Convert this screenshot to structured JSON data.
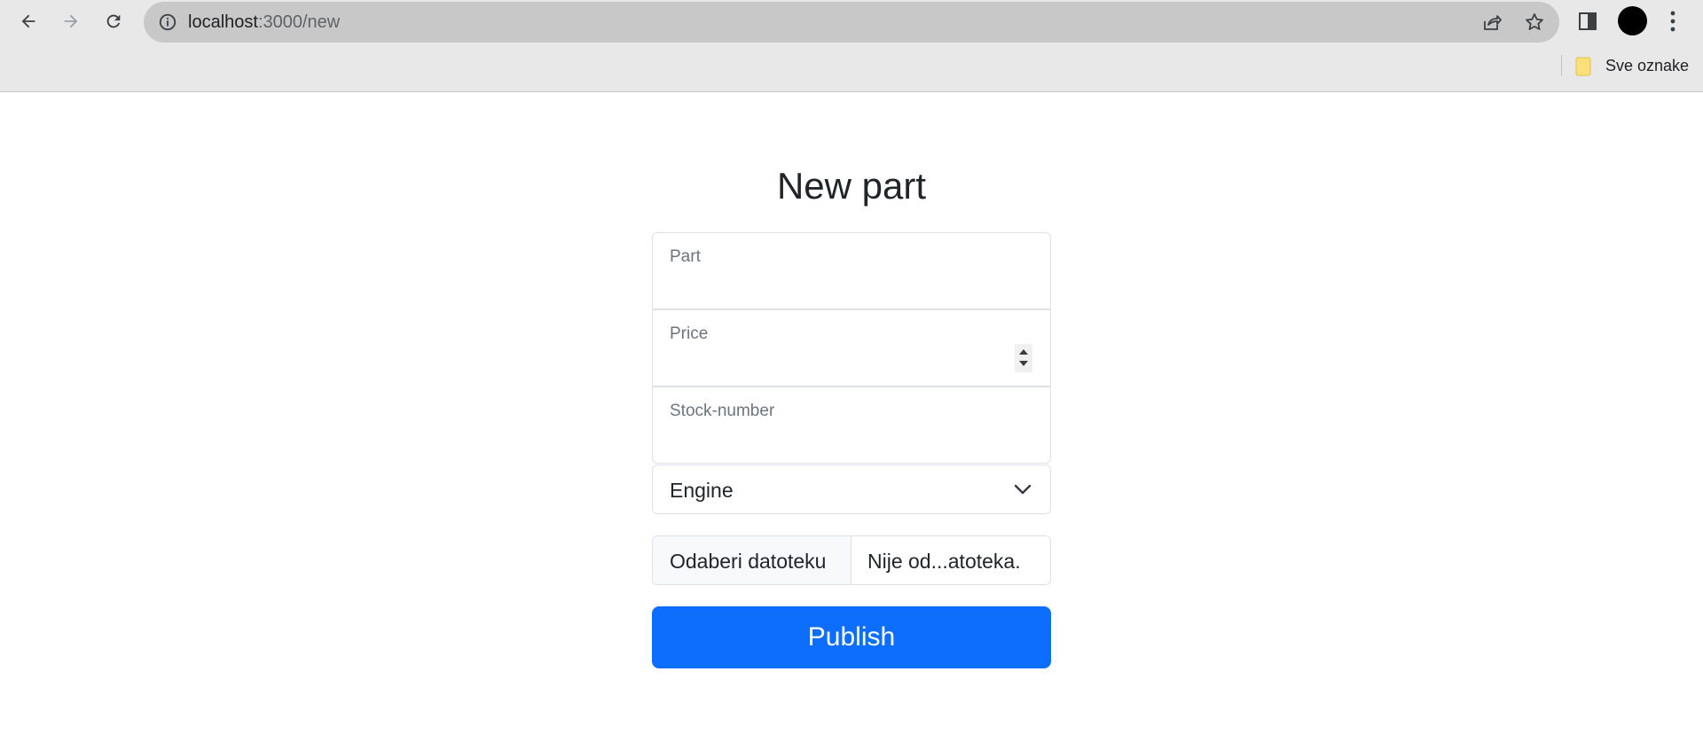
{
  "browser": {
    "url_host": "localhost",
    "url_rest": ":3000/new",
    "bookmark_folder": "Sve oznake",
    "icons": [
      "back-arrow-icon",
      "forward-arrow-icon",
      "reload-icon",
      "info-icon",
      "share-icon",
      "star-icon",
      "side-panel-icon",
      "avatar",
      "kebab-menu-icon",
      "folder-icon"
    ]
  },
  "form": {
    "title": "New part",
    "part_placeholder": "Part",
    "price_placeholder": "Price",
    "stock_placeholder": "Stock-number",
    "category_selected": "Engine",
    "file_button_label": "Odaberi datoteku",
    "file_status": "Nije od...atoteka.",
    "submit_label": "Publish"
  },
  "colors": {
    "primary": "#0d6efd",
    "border": "#dee2e6",
    "placeholder": "#6c757d",
    "text": "#212529"
  }
}
